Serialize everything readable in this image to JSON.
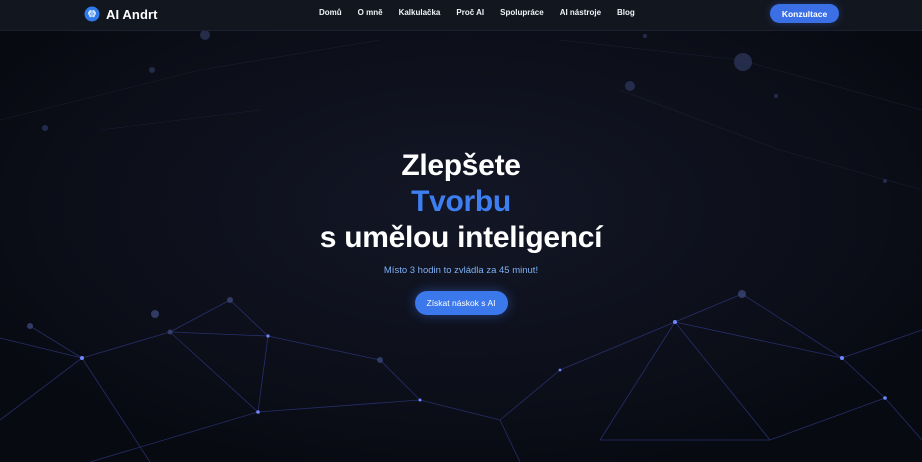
{
  "header": {
    "brand": "AI Andrt",
    "logo_icon": "brain-icon",
    "nav": [
      "Domů",
      "O mně",
      "Kalkulačka",
      "Proč AI",
      "Spolupráce",
      "AI nástroje",
      "Blog"
    ],
    "cta_label": "Konzultace"
  },
  "hero": {
    "title_line1": "Zlepšete",
    "title_line2": "Tvorbu",
    "title_line3": "s umělou inteligencí",
    "subtitle": "Místo 3 hodin to zvládla za 45 minut!",
    "cta_label": "Získat náskok s AI"
  },
  "colors": {
    "background": "#0b0d16",
    "header": "#12161f",
    "accent": "#3b78ec",
    "subtitle": "#7fb1f5"
  }
}
